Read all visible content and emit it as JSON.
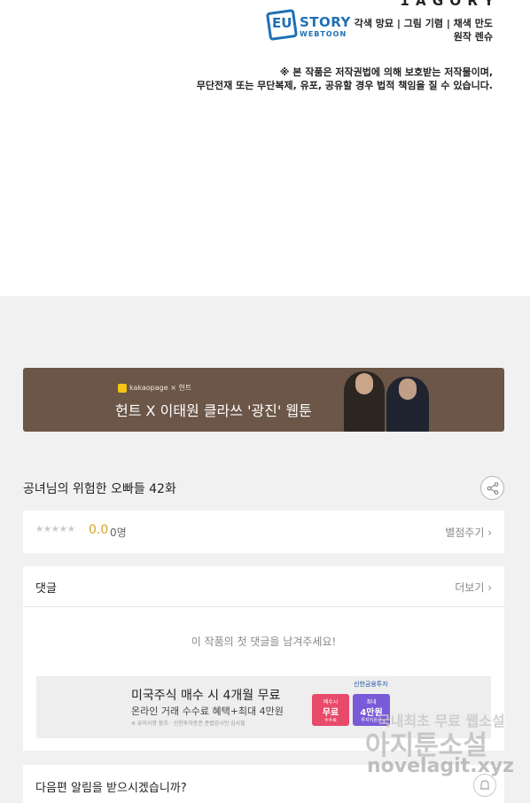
{
  "credits": {
    "top_cut_text": "1 A G O R Y",
    "logo_badge": "EU",
    "logo_story": "STORY",
    "logo_webtoon": "WEBTOON",
    "line1": "각색 망묘  |  그림 기렴  |  채색 만도",
    "line2": "원작 렌슈",
    "notice1": "※ 본 작품은 저작권법에 의해 보호받는 저작물이며,",
    "notice2": "무단전재 또는 무단복제, 유포, 공유할 경우 법적 책임을 질 수 있습니다."
  },
  "banner": {
    "brand": "kakaopage × 헌트",
    "title": "헌트 X 이태원 클라쓰 '광진' 웹툰"
  },
  "episode": {
    "title": "공녀님의 위험한 오빠들 42화"
  },
  "rating": {
    "stars": "★★★★★",
    "score": "0.0",
    "count": "0명",
    "rate_link": "별점주기 ›"
  },
  "comments": {
    "label": "댓글",
    "more_link": "더보기 ›",
    "empty_message": "이 작품의 첫 댓글을 남겨주세요!"
  },
  "ad": {
    "title": "미국주식 매수 시 4개월 무료",
    "subtitle": "온라인 거래 수수료 혜택+최대 4만원",
    "fine_print": "※ 유의사항 참조 · 신한투자증권 준법감시인 심사필",
    "bank": "신한금융투자",
    "card1_small": "매수시",
    "card1_big": "무료",
    "card1_foot": "수수료",
    "card2_small": "최대",
    "card2_big": "4만원",
    "card2_foot": "투자지원금"
  },
  "notify": {
    "text": "다음편 알림을 받으시겠습니까?"
  },
  "watermark": {
    "line1": "국내최초 무료 웹소설",
    "line2": "아지툰소설",
    "line3": "novelagit.xyz"
  }
}
